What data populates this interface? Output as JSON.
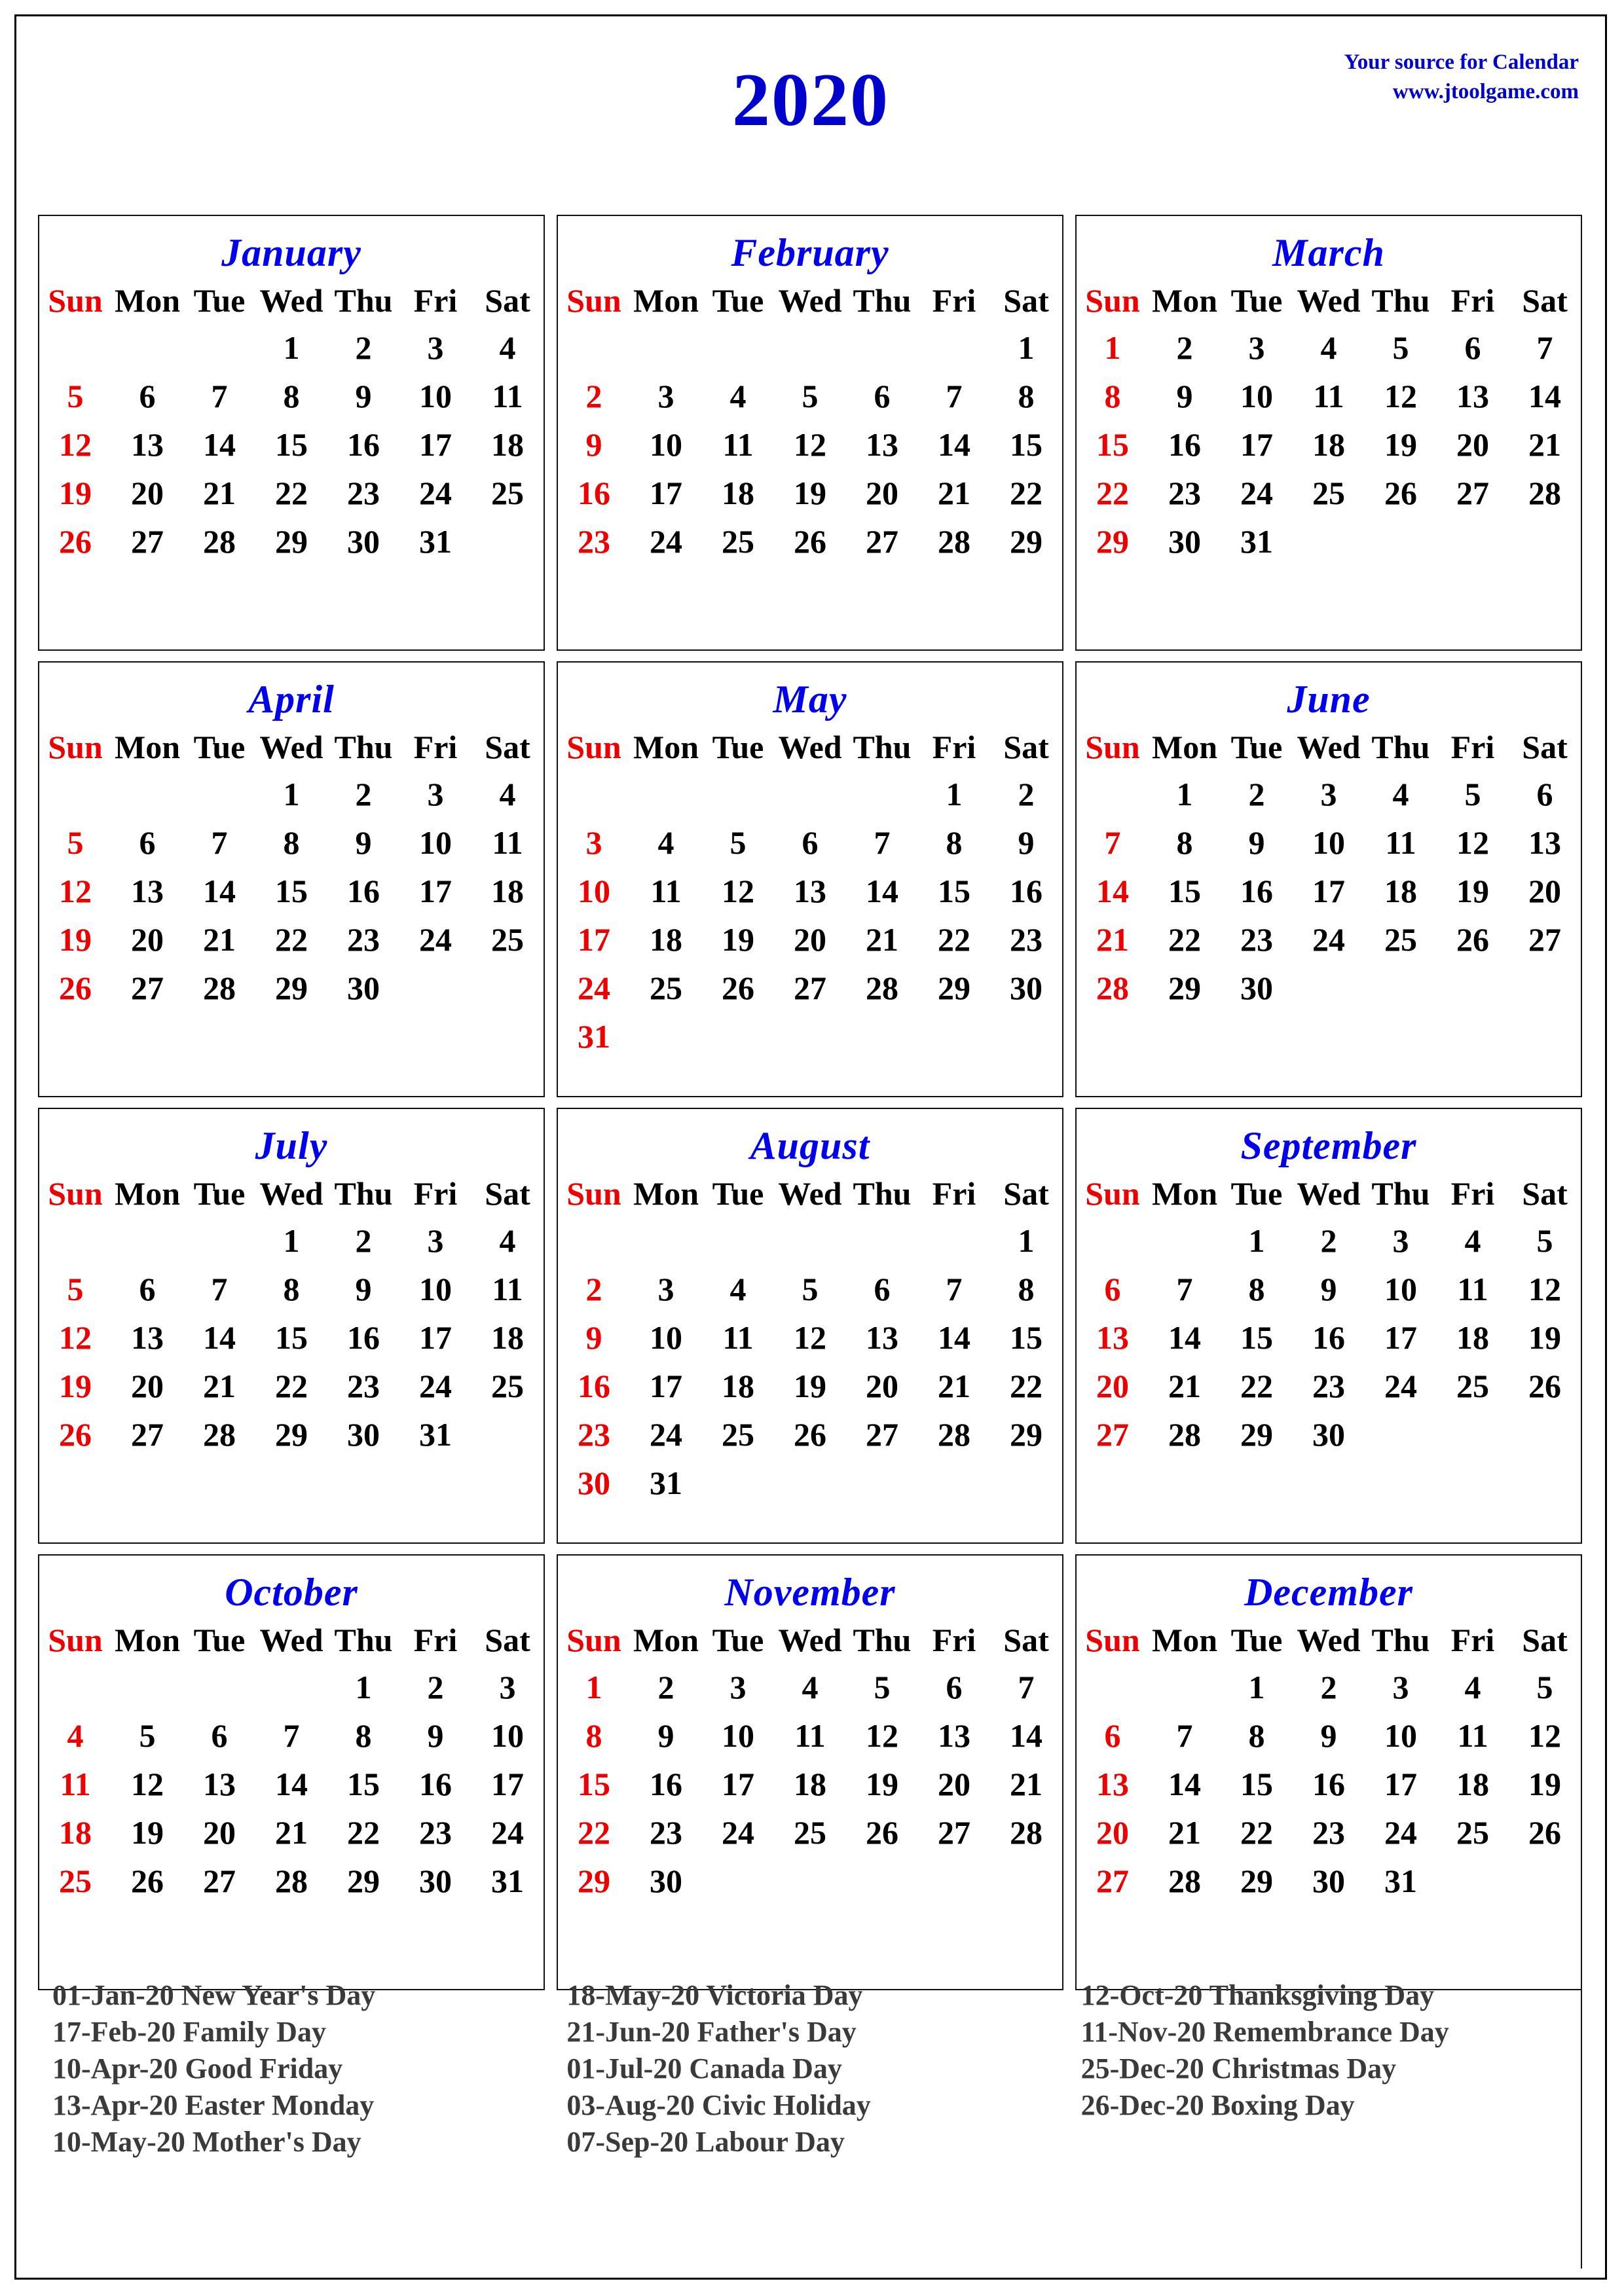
{
  "header": {
    "year": "2020",
    "source_line_1": "Your source for Calendar",
    "source_line_2": "www.jtoolgame.com",
    "title_color": "#0000cc",
    "source_color": "#0000cc"
  },
  "colors": {
    "month_title": "#0000ee",
    "sunday": "#ee0000",
    "weekday": "#000000",
    "holiday_text": "#3a3a3a",
    "border": "#111111",
    "background": "#ffffff"
  },
  "weekday_headers": [
    "Sun",
    "Mon",
    "Tue",
    "Wed",
    "Thu",
    "Fri",
    "Sat"
  ],
  "months": [
    {
      "name": "January",
      "weeks": [
        [
          "",
          "",
          "",
          "1",
          "2",
          "3",
          "4"
        ],
        [
          "5",
          "6",
          "7",
          "8",
          "9",
          "10",
          "11"
        ],
        [
          "12",
          "13",
          "14",
          "15",
          "16",
          "17",
          "18"
        ],
        [
          "19",
          "20",
          "21",
          "22",
          "23",
          "24",
          "25"
        ],
        [
          "26",
          "27",
          "28",
          "29",
          "30",
          "31",
          ""
        ],
        [
          "",
          "",
          "",
          "",
          "",
          "",
          ""
        ]
      ]
    },
    {
      "name": "February",
      "weeks": [
        [
          "",
          "",
          "",
          "",
          "",
          "",
          "1"
        ],
        [
          "2",
          "3",
          "4",
          "5",
          "6",
          "7",
          "8"
        ],
        [
          "9",
          "10",
          "11",
          "12",
          "13",
          "14",
          "15"
        ],
        [
          "16",
          "17",
          "18",
          "19",
          "20",
          "21",
          "22"
        ],
        [
          "23",
          "24",
          "25",
          "26",
          "27",
          "28",
          "29"
        ],
        [
          "",
          "",
          "",
          "",
          "",
          "",
          ""
        ]
      ]
    },
    {
      "name": "March",
      "weeks": [
        [
          "1",
          "2",
          "3",
          "4",
          "5",
          "6",
          "7"
        ],
        [
          "8",
          "9",
          "10",
          "11",
          "12",
          "13",
          "14"
        ],
        [
          "15",
          "16",
          "17",
          "18",
          "19",
          "20",
          "21"
        ],
        [
          "22",
          "23",
          "24",
          "25",
          "26",
          "27",
          "28"
        ],
        [
          "29",
          "30",
          "31",
          "",
          "",
          "",
          ""
        ],
        [
          "",
          "",
          "",
          "",
          "",
          "",
          ""
        ]
      ]
    },
    {
      "name": "April",
      "weeks": [
        [
          "",
          "",
          "",
          "1",
          "2",
          "3",
          "4"
        ],
        [
          "5",
          "6",
          "7",
          "8",
          "9",
          "10",
          "11"
        ],
        [
          "12",
          "13",
          "14",
          "15",
          "16",
          "17",
          "18"
        ],
        [
          "19",
          "20",
          "21",
          "22",
          "23",
          "24",
          "25"
        ],
        [
          "26",
          "27",
          "28",
          "29",
          "30",
          "",
          ""
        ],
        [
          "",
          "",
          "",
          "",
          "",
          "",
          ""
        ]
      ]
    },
    {
      "name": "May",
      "weeks": [
        [
          "",
          "",
          "",
          "",
          "",
          "1",
          "2"
        ],
        [
          "3",
          "4",
          "5",
          "6",
          "7",
          "8",
          "9"
        ],
        [
          "10",
          "11",
          "12",
          "13",
          "14",
          "15",
          "16"
        ],
        [
          "17",
          "18",
          "19",
          "20",
          "21",
          "22",
          "23"
        ],
        [
          "24",
          "25",
          "26",
          "27",
          "28",
          "29",
          "30"
        ],
        [
          "31",
          "",
          "",
          "",
          "",
          "",
          ""
        ]
      ]
    },
    {
      "name": "June",
      "weeks": [
        [
          "",
          "1",
          "2",
          "3",
          "4",
          "5",
          "6"
        ],
        [
          "7",
          "8",
          "9",
          "10",
          "11",
          "12",
          "13"
        ],
        [
          "14",
          "15",
          "16",
          "17",
          "18",
          "19",
          "20"
        ],
        [
          "21",
          "22",
          "23",
          "24",
          "25",
          "26",
          "27"
        ],
        [
          "28",
          "29",
          "30",
          "",
          "",
          "",
          ""
        ],
        [
          "",
          "",
          "",
          "",
          "",
          "",
          ""
        ]
      ]
    },
    {
      "name": "July",
      "weeks": [
        [
          "",
          "",
          "",
          "1",
          "2",
          "3",
          "4"
        ],
        [
          "5",
          "6",
          "7",
          "8",
          "9",
          "10",
          "11"
        ],
        [
          "12",
          "13",
          "14",
          "15",
          "16",
          "17",
          "18"
        ],
        [
          "19",
          "20",
          "21",
          "22",
          "23",
          "24",
          "25"
        ],
        [
          "26",
          "27",
          "28",
          "29",
          "30",
          "31",
          ""
        ],
        [
          "",
          "",
          "",
          "",
          "",
          "",
          ""
        ]
      ]
    },
    {
      "name": "August",
      "weeks": [
        [
          "",
          "",
          "",
          "",
          "",
          "",
          "1"
        ],
        [
          "2",
          "3",
          "4",
          "5",
          "6",
          "7",
          "8"
        ],
        [
          "9",
          "10",
          "11",
          "12",
          "13",
          "14",
          "15"
        ],
        [
          "16",
          "17",
          "18",
          "19",
          "20",
          "21",
          "22"
        ],
        [
          "23",
          "24",
          "25",
          "26",
          "27",
          "28",
          "29"
        ],
        [
          "30",
          "31",
          "",
          "",
          "",
          "",
          ""
        ]
      ]
    },
    {
      "name": "September",
      "weeks": [
        [
          "",
          "",
          "1",
          "2",
          "3",
          "4",
          "5"
        ],
        [
          "6",
          "7",
          "8",
          "9",
          "10",
          "11",
          "12"
        ],
        [
          "13",
          "14",
          "15",
          "16",
          "17",
          "18",
          "19"
        ],
        [
          "20",
          "21",
          "22",
          "23",
          "24",
          "25",
          "26"
        ],
        [
          "27",
          "28",
          "29",
          "30",
          "",
          "",
          ""
        ],
        [
          "",
          "",
          "",
          "",
          "",
          "",
          ""
        ]
      ]
    },
    {
      "name": "October",
      "weeks": [
        [
          "",
          "",
          "",
          "",
          "1",
          "2",
          "3"
        ],
        [
          "4",
          "5",
          "6",
          "7",
          "8",
          "9",
          "10"
        ],
        [
          "11",
          "12",
          "13",
          "14",
          "15",
          "16",
          "17"
        ],
        [
          "18",
          "19",
          "20",
          "21",
          "22",
          "23",
          "24"
        ],
        [
          "25",
          "26",
          "27",
          "28",
          "29",
          "30",
          "31"
        ],
        [
          "",
          "",
          "",
          "",
          "",
          "",
          ""
        ]
      ]
    },
    {
      "name": "November",
      "weeks": [
        [
          "1",
          "2",
          "3",
          "4",
          "5",
          "6",
          "7"
        ],
        [
          "8",
          "9",
          "10",
          "11",
          "12",
          "13",
          "14"
        ],
        [
          "15",
          "16",
          "17",
          "18",
          "19",
          "20",
          "21"
        ],
        [
          "22",
          "23",
          "24",
          "25",
          "26",
          "27",
          "28"
        ],
        [
          "29",
          "30",
          "",
          "",
          "",
          "",
          ""
        ],
        [
          "",
          "",
          "",
          "",
          "",
          "",
          ""
        ]
      ]
    },
    {
      "name": "December",
      "weeks": [
        [
          "",
          "",
          "1",
          "2",
          "3",
          "4",
          "5"
        ],
        [
          "6",
          "7",
          "8",
          "9",
          "10",
          "11",
          "12"
        ],
        [
          "13",
          "14",
          "15",
          "16",
          "17",
          "18",
          "19"
        ],
        [
          "20",
          "21",
          "22",
          "23",
          "24",
          "25",
          "26"
        ],
        [
          "27",
          "28",
          "29",
          "30",
          "31",
          "",
          ""
        ],
        [
          "",
          "",
          "",
          "",
          "",
          "",
          ""
        ]
      ]
    }
  ],
  "holidays": [
    [
      {
        "date": "01-Jan-20",
        "name": "New Year's Day"
      },
      {
        "date": "17-Feb-20",
        "name": "Family Day"
      },
      {
        "date": "10-Apr-20",
        "name": "Good Friday"
      },
      {
        "date": "13-Apr-20",
        "name": "Easter Monday"
      },
      {
        "date": "10-May-20",
        "name": "Mother's Day"
      }
    ],
    [
      {
        "date": "18-May-20",
        "name": "Victoria Day"
      },
      {
        "date": "21-Jun-20",
        "name": "Father's Day"
      },
      {
        "date": "01-Jul-20",
        "name": "Canada Day"
      },
      {
        "date": "03-Aug-20",
        "name": "Civic Holiday"
      },
      {
        "date": "07-Sep-20",
        "name": "Labour Day"
      }
    ],
    [
      {
        "date": "12-Oct-20",
        "name": "Thanksgiving Day"
      },
      {
        "date": "11-Nov-20",
        "name": "Remembrance Day"
      },
      {
        "date": "25-Dec-20",
        "name": "Christmas Day"
      },
      {
        "date": "26-Dec-20",
        "name": "Boxing Day"
      }
    ]
  ]
}
